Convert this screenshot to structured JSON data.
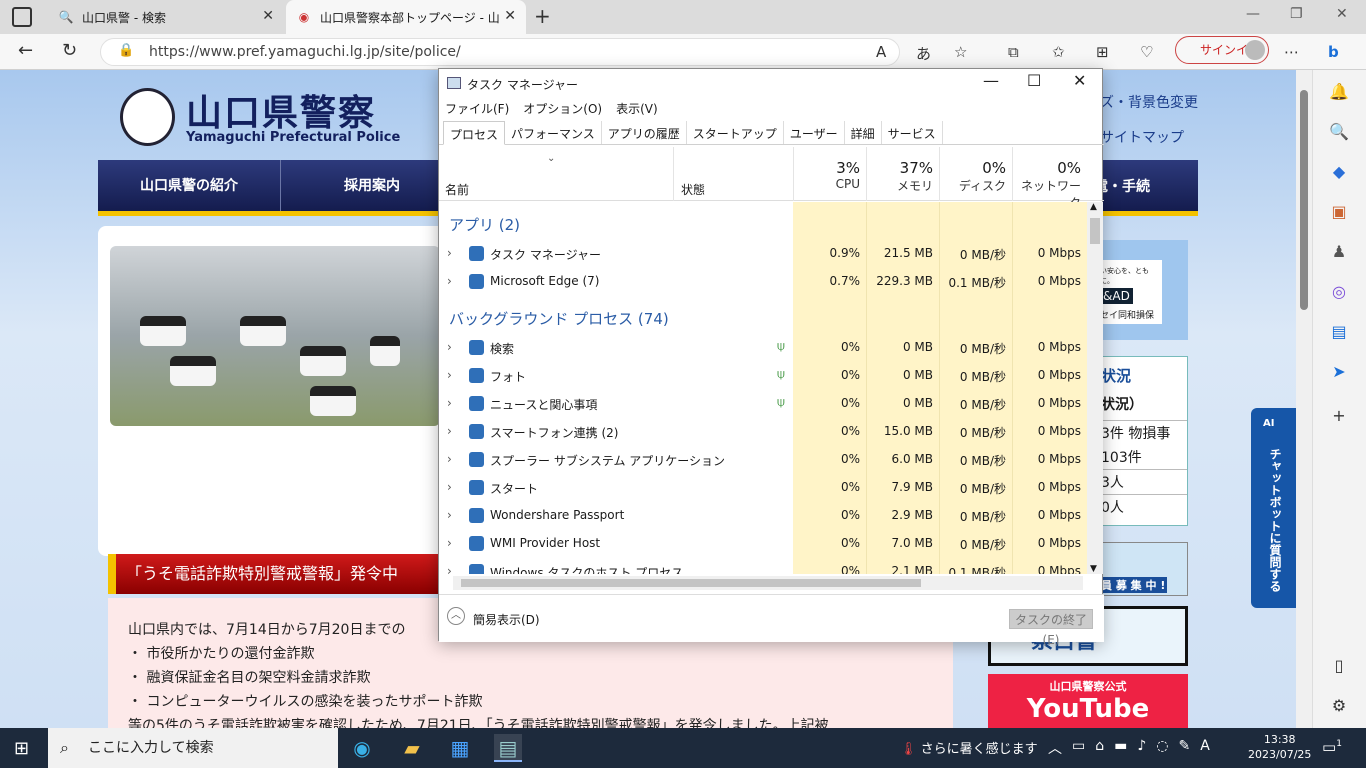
{
  "browser": {
    "tabs": [
      {
        "title": "山口県警 - 検索",
        "icon": "search-icon"
      },
      {
        "title": "山口県警察本部トップページ - 山口",
        "icon": "police-icon",
        "active": true
      }
    ],
    "url": "https://www.pref.yamaguchi.lg.jp/site/police/",
    "signin_label": "サインイン",
    "reader_icon": "A",
    "translate_icon": "あ"
  },
  "site": {
    "logo_title": "山口県警察",
    "logo_sub": "Yamaguchi Prefectural Police",
    "top_link_1": "ズ・背景色変更",
    "top_link_2": "サイトマップ",
    "nav": [
      "山口県警の紹介",
      "採用案内"
    ],
    "nav_right": "電・手続",
    "alert_title": "「うそ電話詐欺特別警戒警報」発令中",
    "alert_lines": [
      "山口県内では、7月14日から7月20日までの",
      "・ 市役所かたりの還付金詐欺",
      "・ 融資保証金名目の架空料金請求詐欺",
      "・ コンピューターウイルスの感染を装ったサポート詐欺",
      "等の5件のうそ電話詐欺被害を確認したため、7月21日、「うそ電話詐欺特別警戒警報」を発令しました。上記被"
    ],
    "ad_tag": "&AD",
    "ad_sub": "セイ同和損保",
    "ad_top": "い安心を、ともに。",
    "accident_title": "状況",
    "accident_sub": "状況）",
    "accident_row1": "3件 物損事",
    "accident_row2": "103件",
    "accident_row3": "3人",
    "accident_row4": "0人",
    "chatbot": "チャットボットに質問する",
    "chatbot_badge": "AI",
    "banner2_text": "察白書",
    "banner3_top": "山口県警察公式",
    "banner3_main": "YouTube",
    "banner1_text": "員 募 集 中 !"
  },
  "taskmanager": {
    "title": "タスク マネージャー",
    "menu": [
      "ファイル(F)",
      "オプション(O)",
      "表示(V)"
    ],
    "tabs": [
      "プロセス",
      "パフォーマンス",
      "アプリの履歴",
      "スタートアップ",
      "ユーザー",
      "詳細",
      "サービス"
    ],
    "headers": {
      "name": "名前",
      "status": "状態",
      "cpu_pct": "3%",
      "cpu": "CPU",
      "mem_pct": "37%",
      "mem": "メモリ",
      "disk_pct": "0%",
      "disk": "ディスク",
      "net_pct": "0%",
      "net": "ネットワーク"
    },
    "group_apps": "アプリ (2)",
    "group_bg": "バックグラウンド プロセス (74)",
    "apps": [
      {
        "name": "タスク マネージャー",
        "cpu": "0.9%",
        "mem": "21.5 MB",
        "disk": "0 MB/秒",
        "net": "0 Mbps"
      },
      {
        "name": "Microsoft Edge (7)",
        "cpu": "0.7%",
        "mem": "229.3 MB",
        "disk": "0.1 MB/秒",
        "net": "0 Mbps"
      }
    ],
    "bg": [
      {
        "name": "検索",
        "cpu": "0%",
        "mem": "0 MB",
        "disk": "0 MB/秒",
        "net": "0 Mbps",
        "leaf": true
      },
      {
        "name": "フォト",
        "cpu": "0%",
        "mem": "0 MB",
        "disk": "0 MB/秒",
        "net": "0 Mbps",
        "leaf": true
      },
      {
        "name": "ニュースと関心事項",
        "cpu": "0%",
        "mem": "0 MB",
        "disk": "0 MB/秒",
        "net": "0 Mbps",
        "leaf": true
      },
      {
        "name": "スマートフォン連携 (2)",
        "cpu": "0%",
        "mem": "15.0 MB",
        "disk": "0 MB/秒",
        "net": "0 Mbps"
      },
      {
        "name": "スプーラー サブシステム アプリケーション",
        "cpu": "0%",
        "mem": "6.0 MB",
        "disk": "0 MB/秒",
        "net": "0 Mbps"
      },
      {
        "name": "スタート",
        "cpu": "0%",
        "mem": "7.9 MB",
        "disk": "0 MB/秒",
        "net": "0 Mbps"
      },
      {
        "name": "Wondershare Passport",
        "cpu": "0%",
        "mem": "2.9 MB",
        "disk": "0 MB/秒",
        "net": "0 Mbps"
      },
      {
        "name": "WMI Provider Host",
        "cpu": "0%",
        "mem": "7.0 MB",
        "disk": "0 MB/秒",
        "net": "0 Mbps"
      },
      {
        "name": "Windows タスクのホスト プロセス",
        "cpu": "0%",
        "mem": "2.1 MB",
        "disk": "0.1 MB/秒",
        "net": "0 Mbps"
      }
    ],
    "fewer_details": "簡易表示(D)",
    "end_task": "タスクの終了(E)"
  },
  "taskbar": {
    "search_placeholder": "ここに入力して検索",
    "weather": "さらに暑く感じます",
    "ime": "A",
    "time": "13:38",
    "date": "2023/07/25",
    "notif_count": "1"
  }
}
